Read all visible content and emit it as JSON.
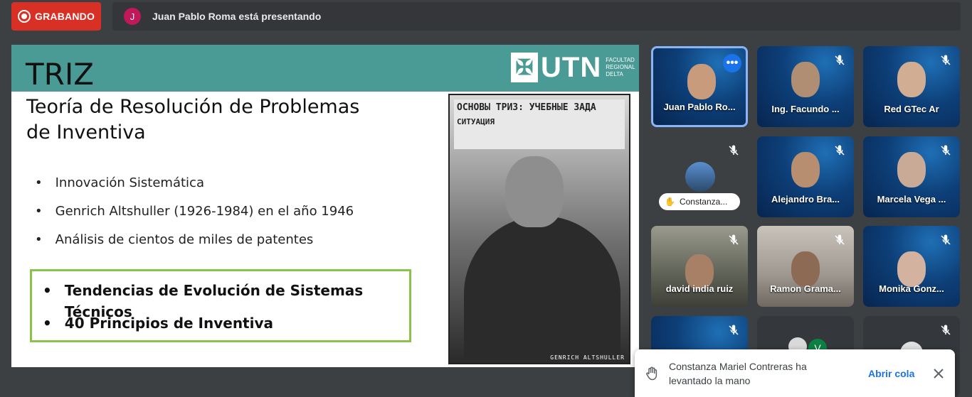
{
  "recording": {
    "label": "GRABANDO"
  },
  "presenter": {
    "initial": "J",
    "text": "Juan Pablo Roma está presentando"
  },
  "slide": {
    "title": "TRIZ",
    "logo": {
      "text": "UTN",
      "faculty": "FACULTAD REGIONAL DELTA"
    },
    "subtitle_line1": "Teoría de Resolución de Problemas",
    "subtitle_line2": "de Inventiva",
    "bullets": [
      "Innovación Sistemática",
      "Genrich Altshuller (1926-1984) en el año 1946",
      "Análisis de cientos de miles de patentes"
    ],
    "highlight_bullets": [
      "Tendencias de Evolución de Sistemas Técnicos",
      "40 Principios de Inventiva"
    ],
    "photo_poster": "ОСНОВЫ ТРИЗ: УЧЕБНЫЕ ЗАДА",
    "photo_poster_sub": "СИТУАЦИЯ",
    "photo_caption": "GENRICH ALTSHULLER"
  },
  "participants": [
    {
      "name": "Juan Pablo Ro...",
      "active": true
    },
    {
      "name": "Ing. Facundo ..."
    },
    {
      "name": "Red GTec Ar"
    },
    {
      "name": "Constanza...",
      "hand_raised": true
    },
    {
      "name": "Alejandro Bra..."
    },
    {
      "name": "Marcela Vega ..."
    },
    {
      "name": "david india ruiz"
    },
    {
      "name": "Ramon Grama..."
    },
    {
      "name": "Monika Gonz..."
    },
    {
      "name": ""
    },
    {
      "name": "",
      "avatar_initial": "V"
    },
    {
      "name": ""
    }
  ],
  "toast": {
    "message": "Constanza Mariel Contreras ha levantado la mano",
    "action": "Abrir cola"
  },
  "colors": {
    "recording": "#d93025",
    "slide_header": "#4a9a96",
    "highlight_border": "#8bc34a",
    "link": "#1a73e8"
  }
}
